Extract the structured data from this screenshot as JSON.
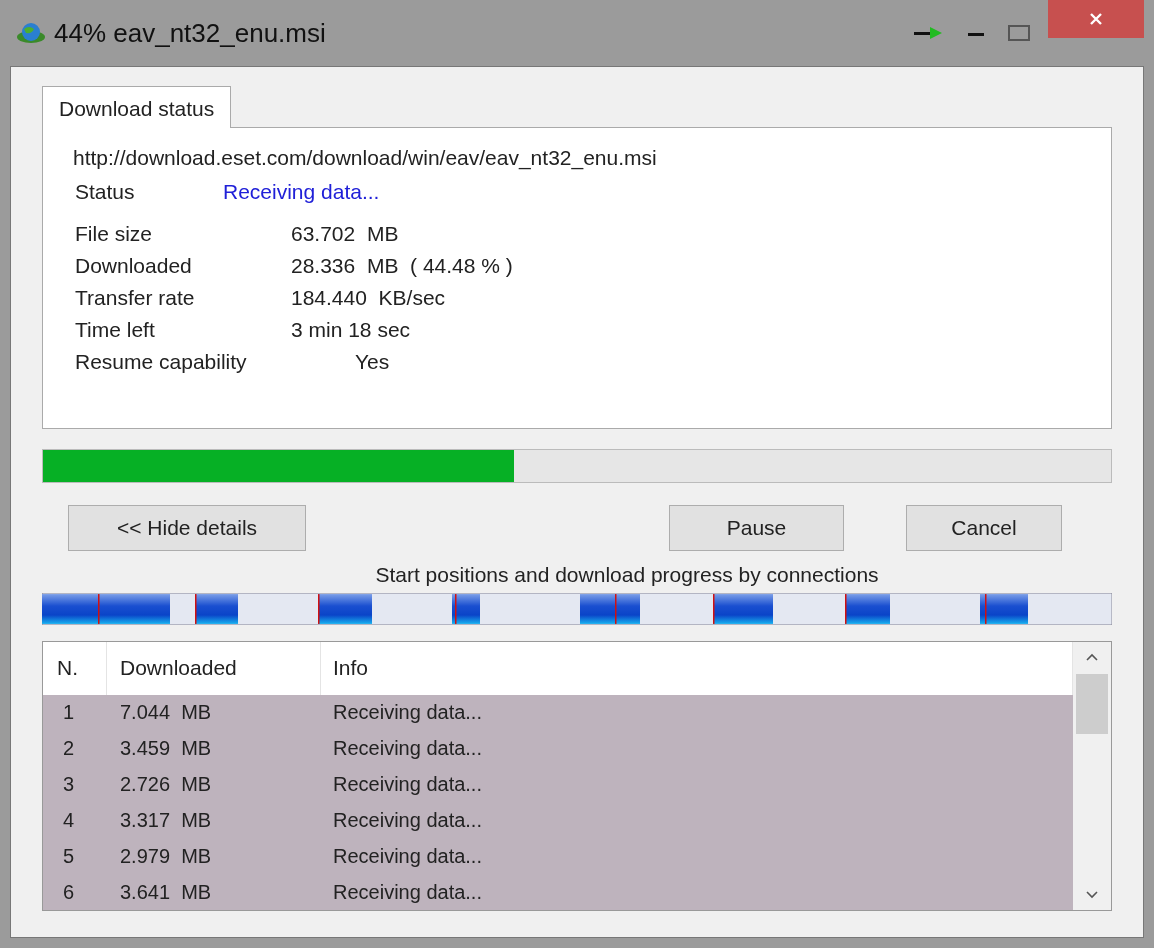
{
  "window": {
    "title": "44% eav_nt32_enu.msi"
  },
  "tabs": [
    {
      "label": "Download status",
      "selected": true
    }
  ],
  "url": "http://download.eset.com/download/win/eav/eav_nt32_enu.msi",
  "status": {
    "label": "Status",
    "value": "Receiving data..."
  },
  "details": [
    {
      "label": "File size",
      "value": "63.702  MB"
    },
    {
      "label": "Downloaded",
      "value": "28.336  MB  ( 44.48 % )"
    },
    {
      "label": "Transfer rate",
      "value": "184.440  KB/sec"
    },
    {
      "label": "Time left",
      "value": "3 min 18 sec"
    },
    {
      "label": "Resume capability",
      "value": "Yes",
      "kind": "indented"
    }
  ],
  "progress": {
    "level": 0.441
  },
  "buttons": {
    "details": "<< Hide details",
    "pause": "Pause",
    "cancel": "Cancel"
  },
  "connections_caption": "Start positions and download progress by connections",
  "table": {
    "columns": [
      "N.",
      "Downloaded",
      "Info"
    ],
    "rows": [
      {
        "n": "1",
        "downloaded": "7.044  MB",
        "info": "Receiving data...",
        "selected": true
      },
      {
        "n": "2",
        "downloaded": "3.459  MB",
        "info": "Receiving data...",
        "selected": true
      },
      {
        "n": "3",
        "downloaded": "2.726  MB",
        "info": "Receiving data...",
        "selected": true
      },
      {
        "n": "4",
        "downloaded": "3.317  MB",
        "info": "Receiving data...",
        "selected": true
      },
      {
        "n": "5",
        "downloaded": "2.979  MB",
        "info": "Receiving data...",
        "selected": true
      },
      {
        "n": "6",
        "downloaded": "3.641  MB",
        "info": "Receiving data...",
        "selected": true
      }
    ]
  }
}
